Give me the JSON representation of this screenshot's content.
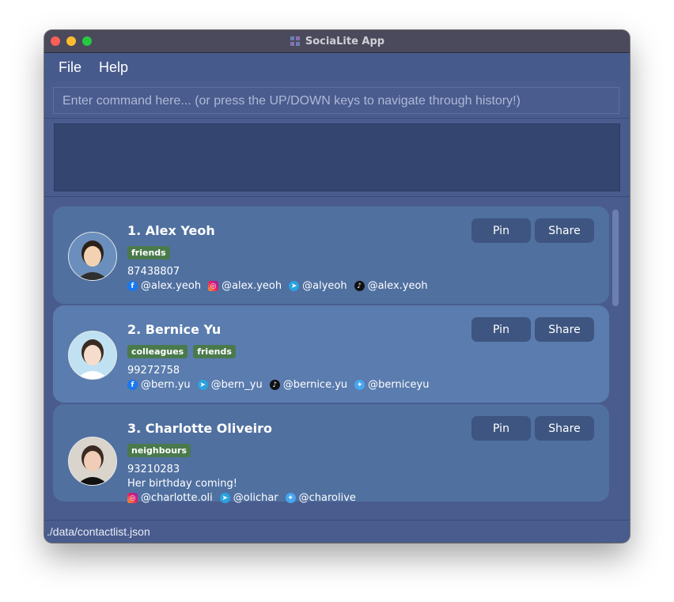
{
  "window": {
    "title": "SociaLite App"
  },
  "menu": {
    "file": "File",
    "help": "Help"
  },
  "command": {
    "placeholder": "Enter command here... (or press the UP/DOWN keys to navigate through history!)"
  },
  "result": {
    "text": ""
  },
  "contacts": [
    {
      "index_name": "1.  Alex Yeoh",
      "tags": [
        "friends"
      ],
      "phone": "87438807",
      "remark": "",
      "socials": [
        {
          "icon": "facebook-icon",
          "handle": "@alex.yeoh"
        },
        {
          "icon": "instagram-icon",
          "handle": "@alex.yeoh"
        },
        {
          "icon": "telegram-icon",
          "handle": "@alyeoh"
        },
        {
          "icon": "tiktok-icon",
          "handle": "@alex.yeoh"
        }
      ],
      "pin_label": "Pin",
      "share_label": "Share"
    },
    {
      "index_name": "2.  Bernice Yu",
      "tags": [
        "colleagues",
        "friends"
      ],
      "phone": "99272758",
      "remark": "",
      "socials": [
        {
          "icon": "facebook-icon",
          "handle": "@bern.yu"
        },
        {
          "icon": "telegram-icon",
          "handle": "@bern_yu"
        },
        {
          "icon": "tiktok-icon",
          "handle": "@bernice.yu"
        },
        {
          "icon": "twitter-icon",
          "handle": "@berniceyu"
        }
      ],
      "pin_label": "Pin",
      "share_label": "Share"
    },
    {
      "index_name": "3.  Charlotte Oliveiro",
      "tags": [
        "neighbours"
      ],
      "phone": "93210283",
      "remark": "Her birthday coming!",
      "socials": [
        {
          "icon": "instagram-icon",
          "handle": "@charlotte.oli"
        },
        {
          "icon": "telegram-icon",
          "handle": "@olichar"
        },
        {
          "icon": "twitter-icon",
          "handle": "@charolive"
        }
      ],
      "pin_label": "Pin",
      "share_label": "Share"
    }
  ],
  "status": {
    "path": "./data/contactlist.json"
  },
  "colors": {
    "window_bg": "#3f4f80",
    "card": "#5070a0",
    "card_alt": "#5a7cae",
    "tag": "#4a7a4c",
    "button": "#3d5580"
  }
}
